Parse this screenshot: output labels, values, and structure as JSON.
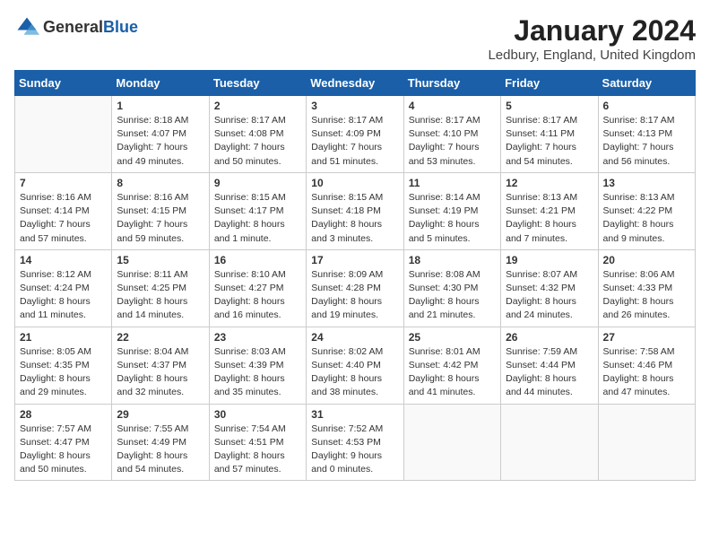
{
  "logo": {
    "text_general": "General",
    "text_blue": "Blue"
  },
  "header": {
    "month_title": "January 2024",
    "location": "Ledbury, England, United Kingdom"
  },
  "days_of_week": [
    "Sunday",
    "Monday",
    "Tuesday",
    "Wednesday",
    "Thursday",
    "Friday",
    "Saturday"
  ],
  "weeks": [
    [
      {
        "day": "",
        "sunrise": "",
        "sunset": "",
        "daylight": "",
        "empty": true
      },
      {
        "day": "1",
        "sunrise": "Sunrise: 8:18 AM",
        "sunset": "Sunset: 4:07 PM",
        "daylight": "Daylight: 7 hours and 49 minutes.",
        "empty": false
      },
      {
        "day": "2",
        "sunrise": "Sunrise: 8:17 AM",
        "sunset": "Sunset: 4:08 PM",
        "daylight": "Daylight: 7 hours and 50 minutes.",
        "empty": false
      },
      {
        "day": "3",
        "sunrise": "Sunrise: 8:17 AM",
        "sunset": "Sunset: 4:09 PM",
        "daylight": "Daylight: 7 hours and 51 minutes.",
        "empty": false
      },
      {
        "day": "4",
        "sunrise": "Sunrise: 8:17 AM",
        "sunset": "Sunset: 4:10 PM",
        "daylight": "Daylight: 7 hours and 53 minutes.",
        "empty": false
      },
      {
        "day": "5",
        "sunrise": "Sunrise: 8:17 AM",
        "sunset": "Sunset: 4:11 PM",
        "daylight": "Daylight: 7 hours and 54 minutes.",
        "empty": false
      },
      {
        "day": "6",
        "sunrise": "Sunrise: 8:17 AM",
        "sunset": "Sunset: 4:13 PM",
        "daylight": "Daylight: 7 hours and 56 minutes.",
        "empty": false
      }
    ],
    [
      {
        "day": "7",
        "sunrise": "Sunrise: 8:16 AM",
        "sunset": "Sunset: 4:14 PM",
        "daylight": "Daylight: 7 hours and 57 minutes.",
        "empty": false
      },
      {
        "day": "8",
        "sunrise": "Sunrise: 8:16 AM",
        "sunset": "Sunset: 4:15 PM",
        "daylight": "Daylight: 7 hours and 59 minutes.",
        "empty": false
      },
      {
        "day": "9",
        "sunrise": "Sunrise: 8:15 AM",
        "sunset": "Sunset: 4:17 PM",
        "daylight": "Daylight: 8 hours and 1 minute.",
        "empty": false
      },
      {
        "day": "10",
        "sunrise": "Sunrise: 8:15 AM",
        "sunset": "Sunset: 4:18 PM",
        "daylight": "Daylight: 8 hours and 3 minutes.",
        "empty": false
      },
      {
        "day": "11",
        "sunrise": "Sunrise: 8:14 AM",
        "sunset": "Sunset: 4:19 PM",
        "daylight": "Daylight: 8 hours and 5 minutes.",
        "empty": false
      },
      {
        "day": "12",
        "sunrise": "Sunrise: 8:13 AM",
        "sunset": "Sunset: 4:21 PM",
        "daylight": "Daylight: 8 hours and 7 minutes.",
        "empty": false
      },
      {
        "day": "13",
        "sunrise": "Sunrise: 8:13 AM",
        "sunset": "Sunset: 4:22 PM",
        "daylight": "Daylight: 8 hours and 9 minutes.",
        "empty": false
      }
    ],
    [
      {
        "day": "14",
        "sunrise": "Sunrise: 8:12 AM",
        "sunset": "Sunset: 4:24 PM",
        "daylight": "Daylight: 8 hours and 11 minutes.",
        "empty": false
      },
      {
        "day": "15",
        "sunrise": "Sunrise: 8:11 AM",
        "sunset": "Sunset: 4:25 PM",
        "daylight": "Daylight: 8 hours and 14 minutes.",
        "empty": false
      },
      {
        "day": "16",
        "sunrise": "Sunrise: 8:10 AM",
        "sunset": "Sunset: 4:27 PM",
        "daylight": "Daylight: 8 hours and 16 minutes.",
        "empty": false
      },
      {
        "day": "17",
        "sunrise": "Sunrise: 8:09 AM",
        "sunset": "Sunset: 4:28 PM",
        "daylight": "Daylight: 8 hours and 19 minutes.",
        "empty": false
      },
      {
        "day": "18",
        "sunrise": "Sunrise: 8:08 AM",
        "sunset": "Sunset: 4:30 PM",
        "daylight": "Daylight: 8 hours and 21 minutes.",
        "empty": false
      },
      {
        "day": "19",
        "sunrise": "Sunrise: 8:07 AM",
        "sunset": "Sunset: 4:32 PM",
        "daylight": "Daylight: 8 hours and 24 minutes.",
        "empty": false
      },
      {
        "day": "20",
        "sunrise": "Sunrise: 8:06 AM",
        "sunset": "Sunset: 4:33 PM",
        "daylight": "Daylight: 8 hours and 26 minutes.",
        "empty": false
      }
    ],
    [
      {
        "day": "21",
        "sunrise": "Sunrise: 8:05 AM",
        "sunset": "Sunset: 4:35 PM",
        "daylight": "Daylight: 8 hours and 29 minutes.",
        "empty": false
      },
      {
        "day": "22",
        "sunrise": "Sunrise: 8:04 AM",
        "sunset": "Sunset: 4:37 PM",
        "daylight": "Daylight: 8 hours and 32 minutes.",
        "empty": false
      },
      {
        "day": "23",
        "sunrise": "Sunrise: 8:03 AM",
        "sunset": "Sunset: 4:39 PM",
        "daylight": "Daylight: 8 hours and 35 minutes.",
        "empty": false
      },
      {
        "day": "24",
        "sunrise": "Sunrise: 8:02 AM",
        "sunset": "Sunset: 4:40 PM",
        "daylight": "Daylight: 8 hours and 38 minutes.",
        "empty": false
      },
      {
        "day": "25",
        "sunrise": "Sunrise: 8:01 AM",
        "sunset": "Sunset: 4:42 PM",
        "daylight": "Daylight: 8 hours and 41 minutes.",
        "empty": false
      },
      {
        "day": "26",
        "sunrise": "Sunrise: 7:59 AM",
        "sunset": "Sunset: 4:44 PM",
        "daylight": "Daylight: 8 hours and 44 minutes.",
        "empty": false
      },
      {
        "day": "27",
        "sunrise": "Sunrise: 7:58 AM",
        "sunset": "Sunset: 4:46 PM",
        "daylight": "Daylight: 8 hours and 47 minutes.",
        "empty": false
      }
    ],
    [
      {
        "day": "28",
        "sunrise": "Sunrise: 7:57 AM",
        "sunset": "Sunset: 4:47 PM",
        "daylight": "Daylight: 8 hours and 50 minutes.",
        "empty": false
      },
      {
        "day": "29",
        "sunrise": "Sunrise: 7:55 AM",
        "sunset": "Sunset: 4:49 PM",
        "daylight": "Daylight: 8 hours and 54 minutes.",
        "empty": false
      },
      {
        "day": "30",
        "sunrise": "Sunrise: 7:54 AM",
        "sunset": "Sunset: 4:51 PM",
        "daylight": "Daylight: 8 hours and 57 minutes.",
        "empty": false
      },
      {
        "day": "31",
        "sunrise": "Sunrise: 7:52 AM",
        "sunset": "Sunset: 4:53 PM",
        "daylight": "Daylight: 9 hours and 0 minutes.",
        "empty": false
      },
      {
        "day": "",
        "sunrise": "",
        "sunset": "",
        "daylight": "",
        "empty": true
      },
      {
        "day": "",
        "sunrise": "",
        "sunset": "",
        "daylight": "",
        "empty": true
      },
      {
        "day": "",
        "sunrise": "",
        "sunset": "",
        "daylight": "",
        "empty": true
      }
    ]
  ]
}
